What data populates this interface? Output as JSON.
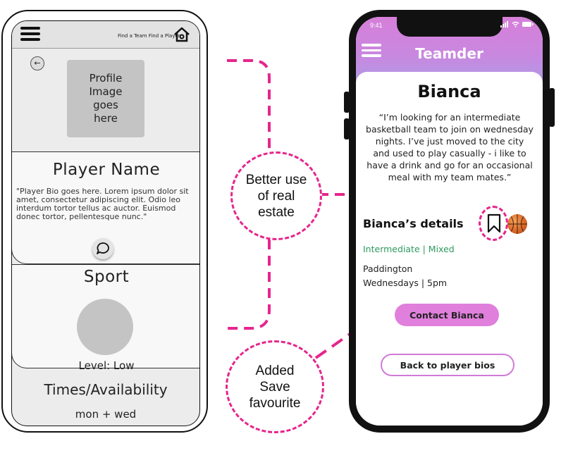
{
  "wireframe": {
    "nav_links": "Find a Team Find a Player",
    "profile_image_text": "Profile\nImage\ngoes\nhere",
    "player_name": "Player Name",
    "player_bio": "\"Player Bio goes here. Lorem ipsum dolor sit amet, consectetur adipiscing elit. Odio leo interdum tortor tellus ac auctor. Euismod donec tortor, pellentesque nunc.\"",
    "sport_title": "Sport",
    "level": "Level: Low",
    "times_title": "Times/Availability",
    "days": "mon + wed"
  },
  "annotations": {
    "real_estate": "Better use\nof real\nestate",
    "save_favourite": "Added\nSave\nfavourite",
    "accent_color": "#e6258c"
  },
  "app": {
    "time": "9:41",
    "brand": "Teamder",
    "profile_name": "Bianca",
    "quote": "“I’m looking for an intermediate basketball team to join on wednesday nights. I’ve just moved to the city and used to play casually - i like to have a drink and go for an occasional meal with my team mates.”",
    "details_title": "Bianca’s details",
    "level_type": "Intermediate | Mixed",
    "location": "Paddington",
    "schedule": "Wednesdays | 5pm",
    "contact_button": "Contact Bianca",
    "back_button": "Back to player bios",
    "colors": {
      "header_start": "#d67fd8",
      "header_end": "#a99ee6",
      "level_green": "#2e9a5e",
      "button_pink": "#e07fdc"
    },
    "icons": [
      "menu-icon",
      "bookmark-icon",
      "basketball-icon"
    ]
  }
}
